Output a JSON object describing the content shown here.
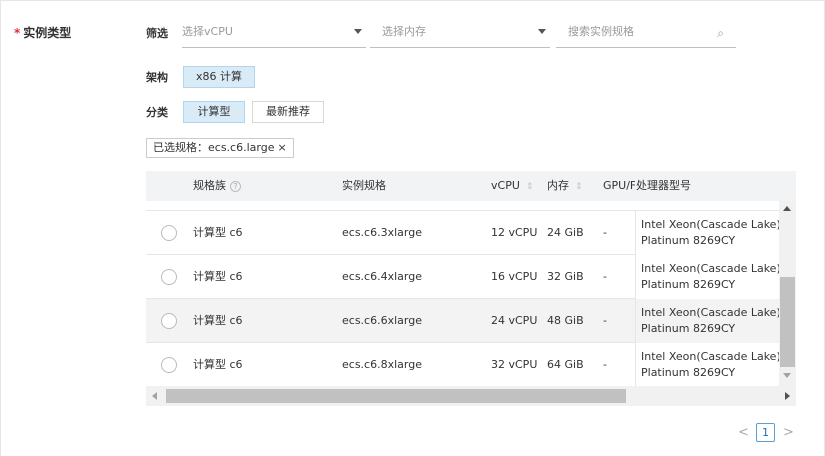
{
  "form": {
    "required_mark": "*",
    "instance_type_label": "实例类型"
  },
  "filter": {
    "label": "筛选",
    "vcpu_placeholder": "选择vCPU",
    "memory_placeholder": "选择内存",
    "search_placeholder": "搜索实例规格"
  },
  "architecture": {
    "label": "架构",
    "options": [
      "x86 计算"
    ]
  },
  "category": {
    "label": "分类",
    "options": [
      "计算型",
      "最新推荐"
    ]
  },
  "selected_tag": {
    "text": "已选规格：ecs.c6.large",
    "close_glyph": "×"
  },
  "table": {
    "headers": {
      "family": "规格族",
      "spec": "实例规格",
      "vcpu": "vCPU",
      "memory": "内存",
      "gpu": "GPU/FP",
      "cpu_model": "处理器型号"
    },
    "rows": [
      {
        "family": "计算型 c6",
        "spec": "ecs.c6.3xlarge",
        "vcpu": "12 vCPU",
        "memory": "24 GiB",
        "gpu": "-",
        "cpu_line1": "Intel Xeon(Cascade Lake)",
        "cpu_line2": "Platinum 8269CY"
      },
      {
        "family": "计算型 c6",
        "spec": "ecs.c6.4xlarge",
        "vcpu": "16 vCPU",
        "memory": "32 GiB",
        "gpu": "-",
        "cpu_line1": "Intel Xeon(Cascade Lake)",
        "cpu_line2": "Platinum 8269CY"
      },
      {
        "family": "计算型 c6",
        "spec": "ecs.c6.6xlarge",
        "vcpu": "24 vCPU",
        "memory": "48 GiB",
        "gpu": "-",
        "cpu_line1": "Intel Xeon(Cascade Lake)",
        "cpu_line2": "Platinum 8269CY"
      },
      {
        "family": "计算型 c6",
        "spec": "ecs.c6.8xlarge",
        "vcpu": "32 vCPU",
        "memory": "64 GiB",
        "gpu": "-",
        "cpu_line1": "Intel Xeon(Cascade Lake)",
        "cpu_line2": "Platinum 8269CY"
      }
    ]
  },
  "pagination": {
    "prev": "<",
    "current": "1",
    "next": ">"
  },
  "colors": {
    "required": "#e0302f",
    "active_chip_bg": "#d9ebf7",
    "pager_accent": "#1d6fb8"
  },
  "icons": [
    "search-icon",
    "help-icon",
    "sort-icon",
    "chevron-down-icon",
    "close-icon"
  ]
}
